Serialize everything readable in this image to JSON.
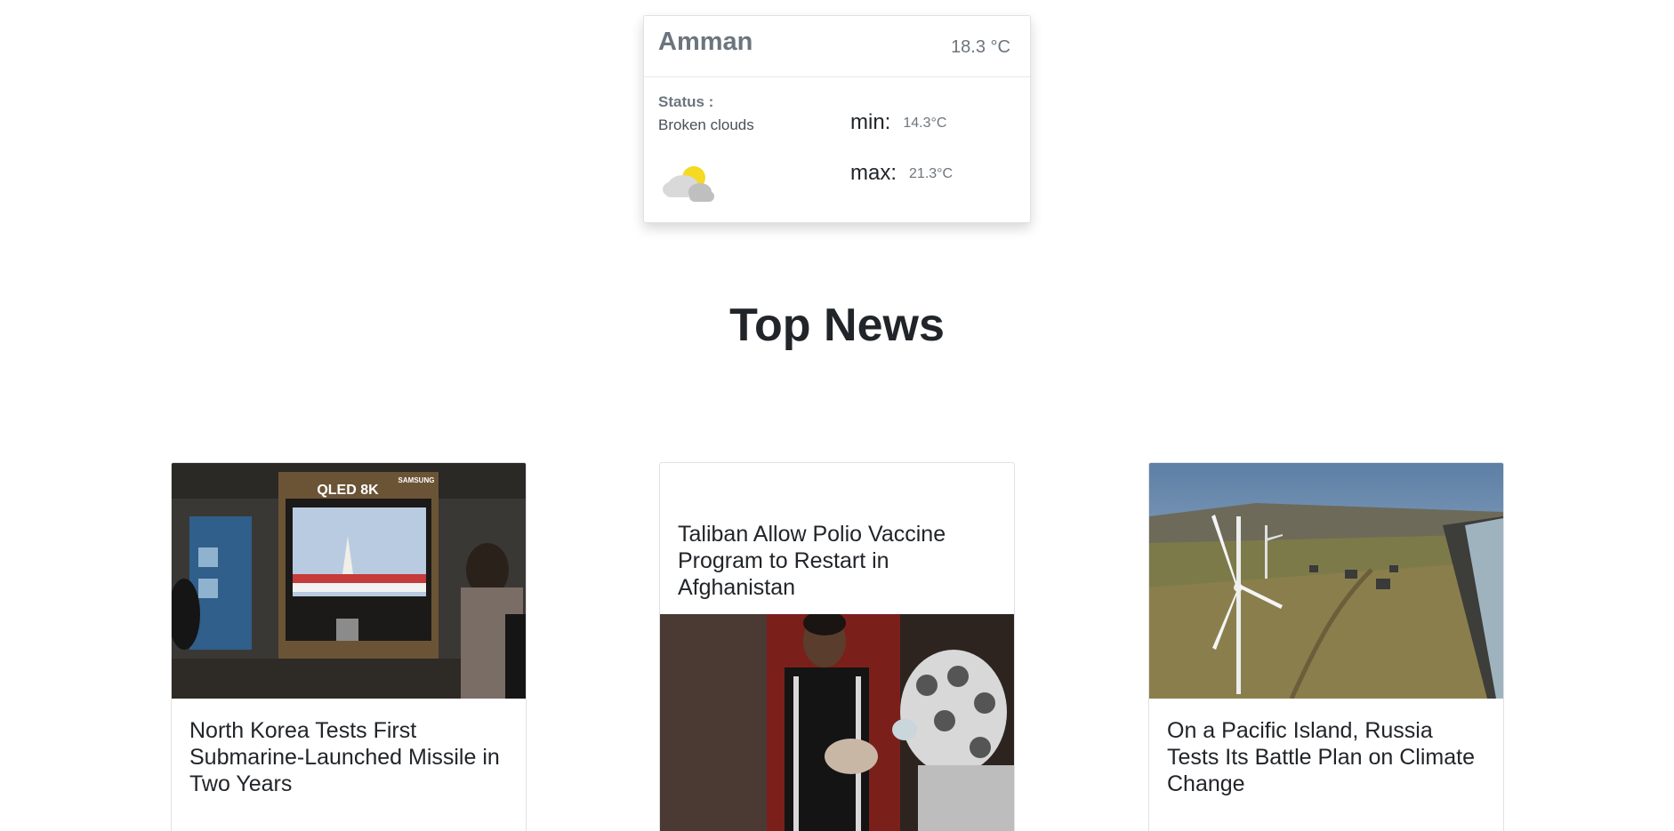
{
  "weather": {
    "city": "Amman",
    "temperature": "18.3 °C",
    "status_label": "Status :",
    "status_value": "Broken clouds",
    "icon": "broken-clouds-icon",
    "min_label": "min:",
    "min_value": "14.3°C",
    "max_label": "max:",
    "max_value": "21.3°C"
  },
  "section": {
    "title": "Top News"
  },
  "news": [
    {
      "title": "North Korea Tests First Submarine-Launched Missile in Two Years",
      "image": "tv-showing-missile-launch-photo",
      "image_text": {
        "brand": "QLED 8K",
        "maker": "SAMSUNG"
      }
    },
    {
      "title": "Taliban Allow Polio Vaccine Program to Restart in Afghanistan",
      "image": "polio-vaccination-photo"
    },
    {
      "title": "On a Pacific Island, Russia Tests Its Battle Plan on Climate Change",
      "image": "wind-turbine-island-photo"
    }
  ]
}
